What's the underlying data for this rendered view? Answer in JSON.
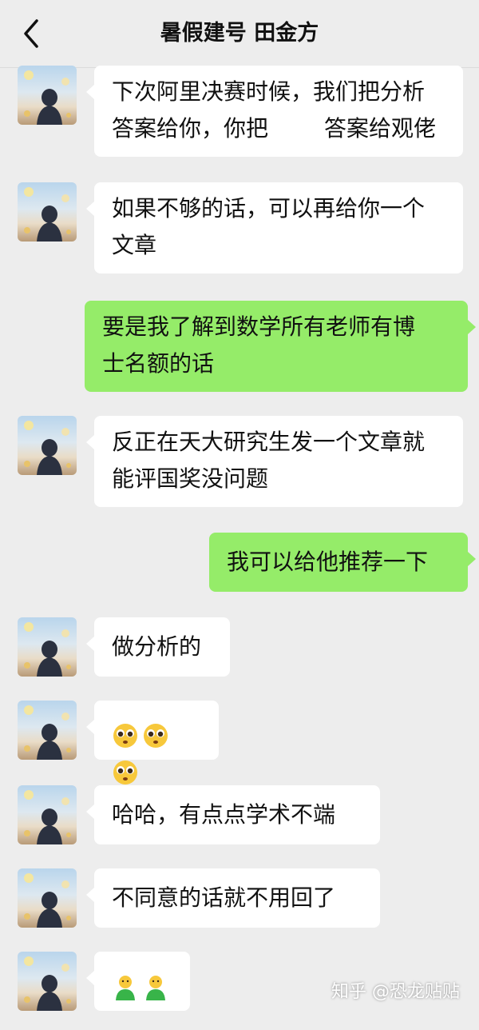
{
  "header": {
    "title": "暑假建号 田金方",
    "back_icon": "chevron-left-icon"
  },
  "messages": [
    {
      "side": "left",
      "lines": [
        "下次阿里决赛时候，我们把分析",
        "答案给你，你把",
        "答案给观佬"
      ]
    },
    {
      "side": "left",
      "lines": [
        "如果不够的话，可以再给你一个",
        "文章"
      ]
    },
    {
      "side": "right",
      "lines": [
        "要是我了解到数学所有老师有博",
        "士名额的话"
      ]
    },
    {
      "side": "left",
      "lines": [
        "反正在天大研究生发一个文章就",
        "能评国奖没问题"
      ]
    },
    {
      "side": "right",
      "lines": [
        "我可以给他推荐一下"
      ]
    },
    {
      "side": "left",
      "lines": [
        "做分析的"
      ]
    },
    {
      "side": "left",
      "emoji": [
        "pleading-face-emoji",
        "pleading-face-emoji",
        "pleading-face-emoji"
      ]
    },
    {
      "side": "left",
      "lines": [
        "哈哈，有点点学术不端"
      ]
    },
    {
      "side": "left",
      "lines": [
        "不同意的话就不用回了"
      ]
    },
    {
      "side": "left",
      "emoji": [
        "person-emoji",
        "person-emoji"
      ]
    }
  ],
  "watermark": "知乎 @恐龙贴贴",
  "colors": {
    "background": "#ededed",
    "bubble_self": "#95ec69",
    "bubble_other": "#ffffff"
  }
}
